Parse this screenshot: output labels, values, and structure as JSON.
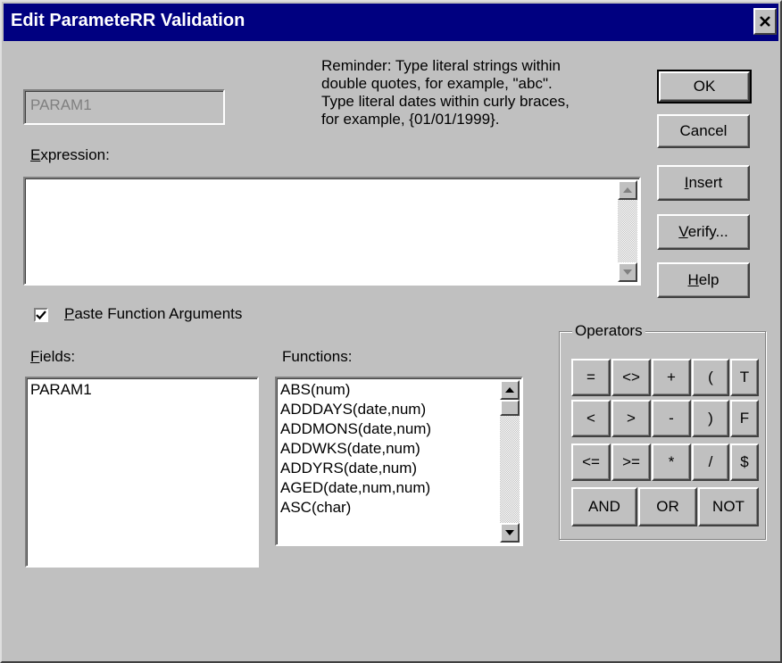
{
  "window": {
    "title": "Edit ParameteRR Validation"
  },
  "reminder": {
    "lines": [
      "Reminder: Type literal strings within",
      "double quotes, for example, \"abc\".",
      "Type literal dates within curly braces,",
      "for example, {01/01/1999}."
    ]
  },
  "parameter": {
    "value": "PARAM1"
  },
  "expression": {
    "label": "Expression:",
    "value": ""
  },
  "buttons": {
    "ok": "OK",
    "cancel": "Cancel",
    "insert": "Insert",
    "verify": "Verify...",
    "help": "Help"
  },
  "paste_args": {
    "label": "Paste Function Arguments",
    "checked": true
  },
  "fields": {
    "label": "Fields:",
    "items": [
      "PARAM1"
    ]
  },
  "functions": {
    "label": "Functions:",
    "items": [
      "ABS(num)",
      "ADDDAYS(date,num)",
      "ADDMONS(date,num)",
      "ADDWKS(date,num)",
      "ADDYRS(date,num)",
      "AGED(date,num,num)",
      "ASC(char)"
    ]
  },
  "operators": {
    "label": "Operators",
    "row1": [
      "=",
      "<>",
      "+",
      "(",
      "T"
    ],
    "row2": [
      "<",
      ">",
      "-",
      ")",
      "F"
    ],
    "row3": [
      "<=",
      ">=",
      "*",
      "/",
      "$"
    ],
    "row4": [
      "AND",
      "OR",
      "NOT"
    ]
  },
  "colors": {
    "titlebar": "#000080",
    "face": "#c0c0c0"
  }
}
